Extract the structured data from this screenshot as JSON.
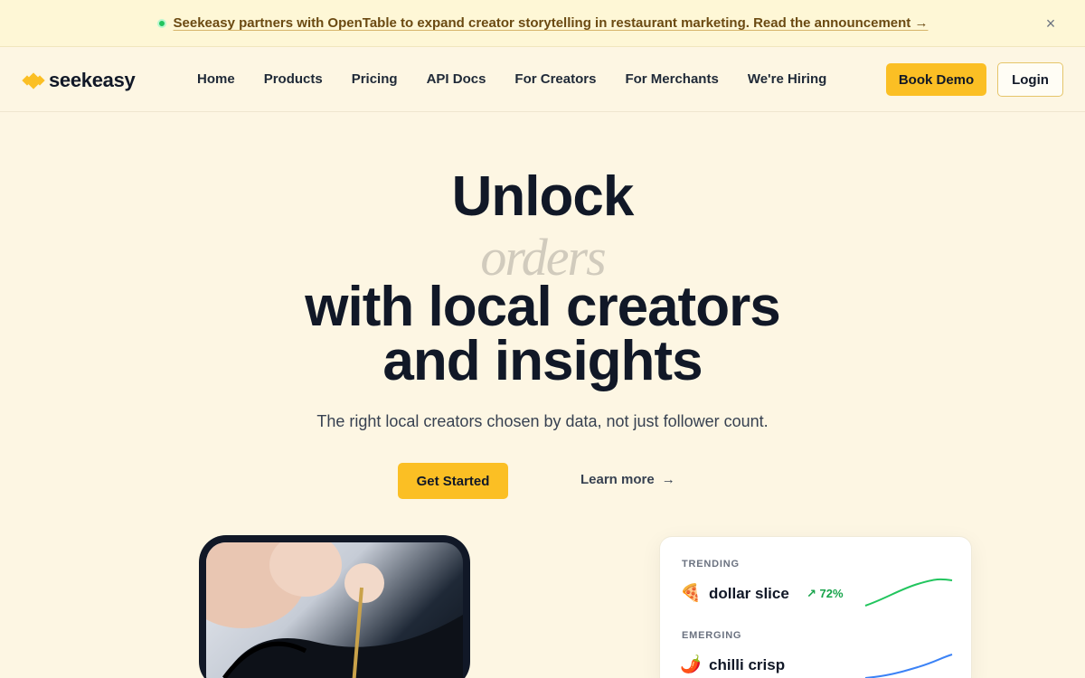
{
  "banner": {
    "text": "Seekeasy partners with OpenTable to expand creator storytelling in restaurant marketing. Read the announcement →",
    "close_icon": "close-icon",
    "close_glyph": "×"
  },
  "nav": {
    "logo_text": "seekeasy",
    "links": [
      "Home",
      "Products",
      "Pricing",
      "API Docs",
      "For Creators",
      "For Merchants",
      "We're Hiring"
    ],
    "book_demo": "Book Demo",
    "login": "Login"
  },
  "hero": {
    "line1": "Unlock",
    "rotating_word": "orders",
    "line3": "with local creators",
    "line4": "and insights",
    "subtitle": "The right local creators chosen by data, not just follower count.",
    "cta_primary": "Get Started",
    "cta_secondary": "Learn more",
    "cta_secondary_arrow": "→"
  },
  "trends": {
    "rows": [
      {
        "label": "TRENDING",
        "emoji": "🍕",
        "name": "dollar slice",
        "change": "↗ 72%",
        "color": "#22c55e"
      },
      {
        "label": "EMERGING",
        "emoji": "🌶️",
        "name": "chilli crisp",
        "change": "",
        "color": "#3b82f6"
      }
    ]
  },
  "colors": {
    "accent": "#fbbf24",
    "background": "#fdf6e3",
    "banner": "#fef7d6"
  }
}
